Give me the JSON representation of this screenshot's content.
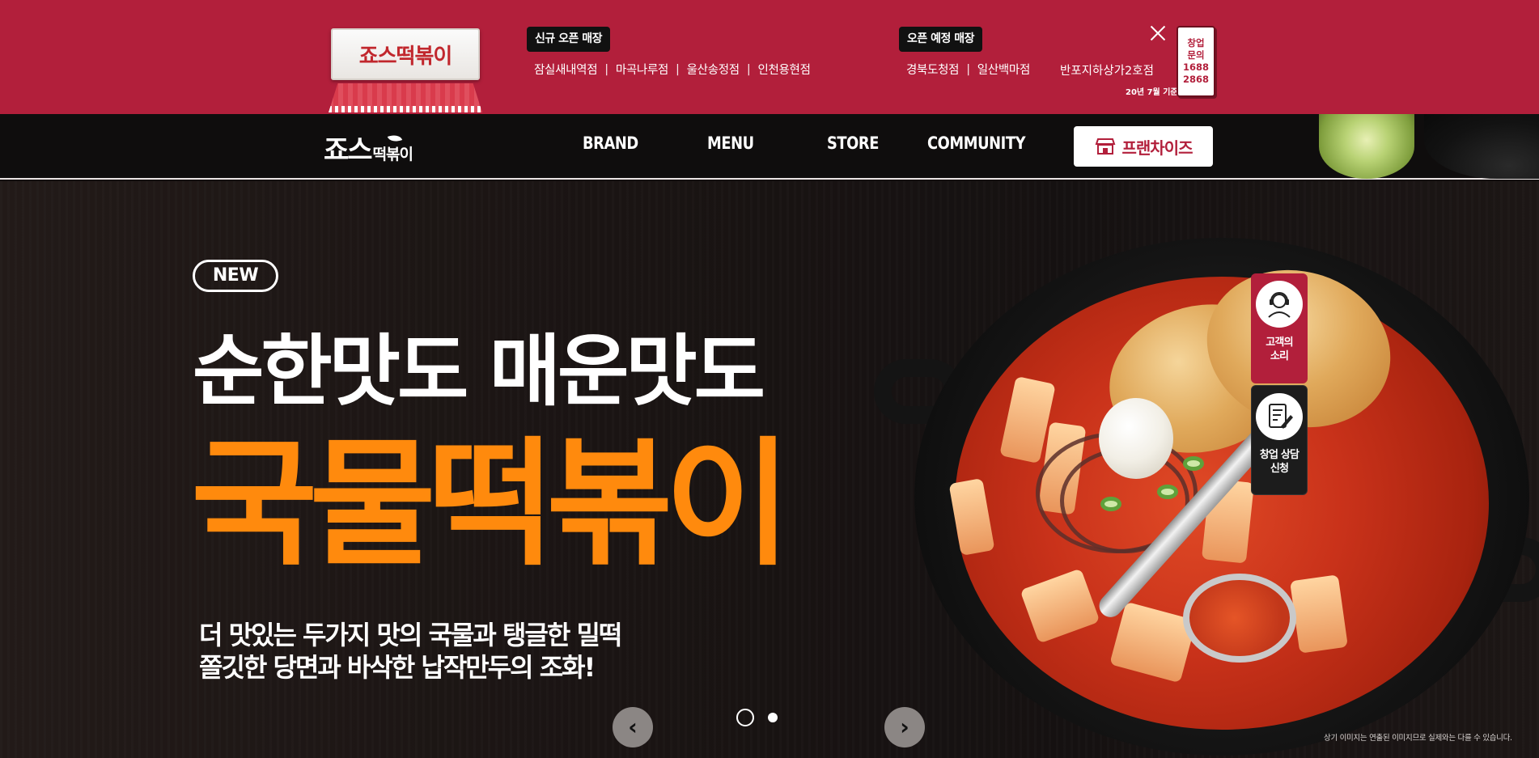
{
  "top_bar": {
    "new_stores_tag": "신규 오픈 매장",
    "new_stores": [
      "잠실새내역점",
      "마곡나루점",
      "울산송정점",
      "인천용현점"
    ],
    "upcoming_tag": "오픈 예정 매장",
    "upcoming_stores": [
      "경북도청점",
      "일산백마점"
    ],
    "extra_store": "반포지하상가2호점",
    "date_note": "20년 7월 기준",
    "inquiry_lines": [
      "창업",
      "문의",
      "1688",
      "2868"
    ],
    "store_sign": "죠스떡볶이",
    "close_icon": "close-icon"
  },
  "nav": {
    "logo_main": "죠스",
    "logo_sub": "떡볶이",
    "items": [
      "BRAND",
      "MENU",
      "STORE",
      "COMMUNITY"
    ],
    "franchise_label": "프랜차이즈",
    "franchise_icon": "store-icon"
  },
  "hero": {
    "badge": "NEW",
    "headline": "순한맛도 매운맛도",
    "title": "국물떡볶이",
    "desc_line1": "더 맛있는 두가지 맛의 국물과 탱글한 밀떡",
    "desc_line2": "쫄깃한 당면과 바삭한 납작만두의 조화!",
    "disclaimer": "상기 이미지는 연출된 이미지므로 실제와는 다를 수 있습니다."
  },
  "side_buttons": {
    "voice_label_line1": "고객의",
    "voice_label_line2": "소리",
    "consult_label_line1": "창업 상담",
    "consult_label_line2": "신청"
  },
  "slider": {
    "prev_icon": "chevron-left-icon",
    "next_icon": "chevron-right-icon",
    "prev_glyph": "‹",
    "next_glyph": "›",
    "total_slides": 2,
    "active_slide": 2
  },
  "colors": {
    "brand_red": "#b21f3b",
    "accent_orange": "#ff8a0d",
    "nav_bg": "#0f0d0d"
  }
}
